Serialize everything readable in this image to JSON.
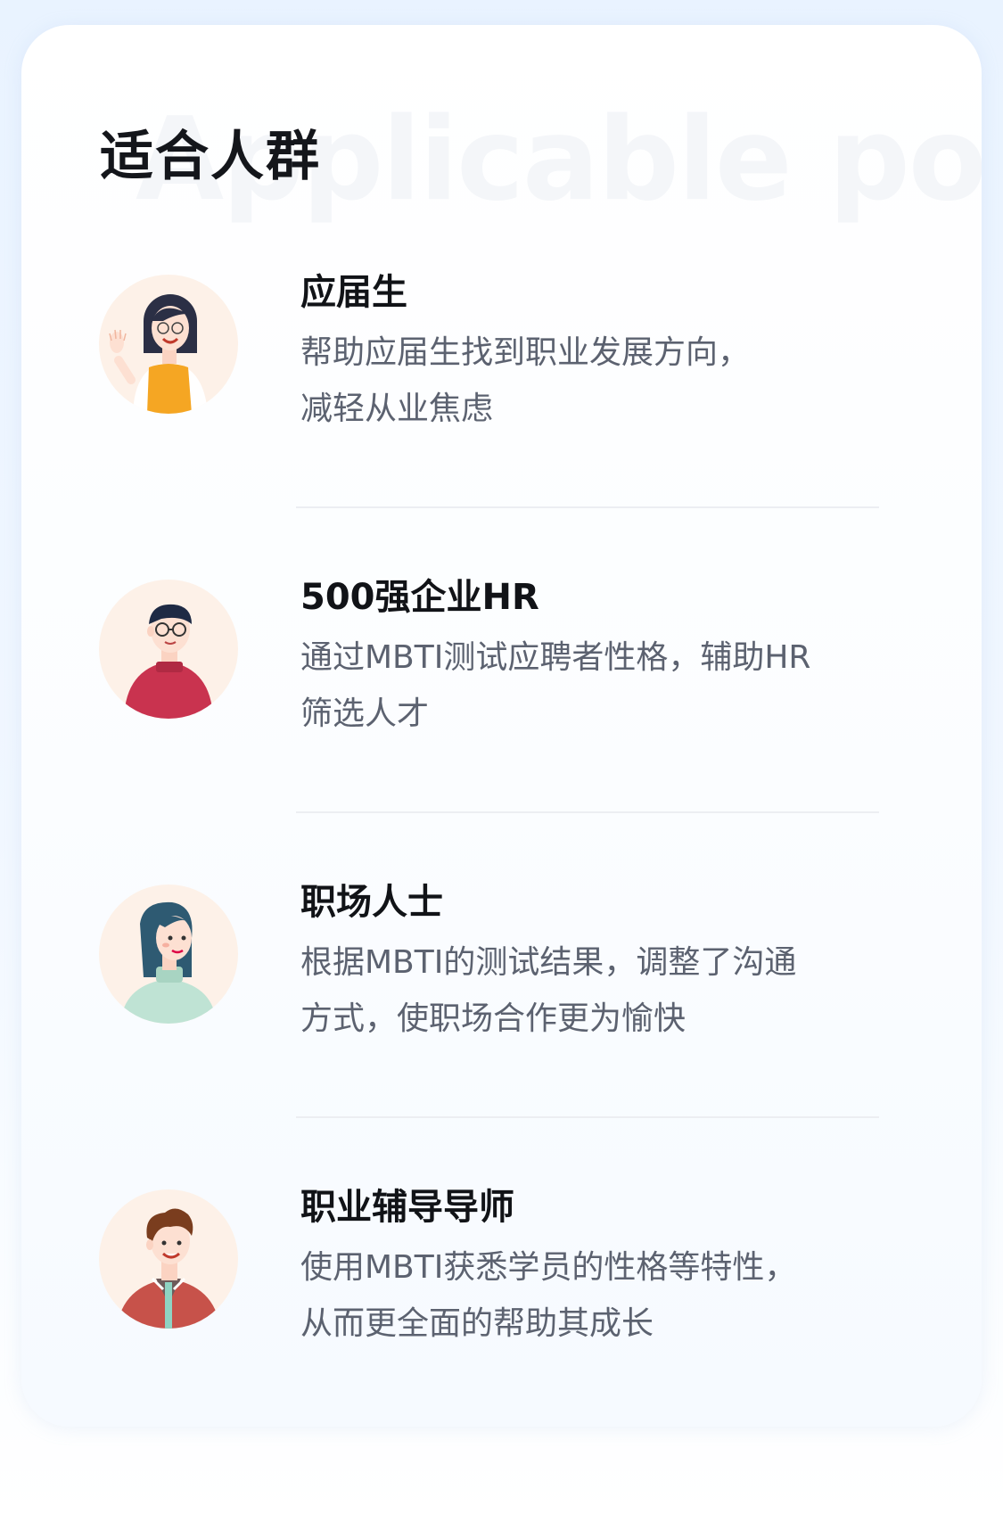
{
  "section": {
    "title": "适合人群",
    "bg_text": "Applicable populati"
  },
  "items": [
    {
      "title": "应届生",
      "desc_lines": [
        "帮助应届生找到职业发展方向，",
        "减轻从业焦虑"
      ],
      "icon": "graduate-woman-avatar-icon"
    },
    {
      "title": "500强企业HR",
      "desc_lines": [
        "通过MBTI测试应聘者性格，辅助HR",
        "筛选人才"
      ],
      "icon": "hr-man-avatar-icon"
    },
    {
      "title": "职场人士",
      "desc_lines": [
        "根据MBTI的测试结果，调整了沟通",
        "方式，使职场合作更为愉快"
      ],
      "icon": "professional-woman-avatar-icon"
    },
    {
      "title": "职业辅导导师",
      "desc_lines": [
        "使用MBTI获悉学员的性格等特性，",
        "从而更全面的帮助其成长"
      ],
      "icon": "mentor-man-avatar-icon"
    }
  ],
  "colors": {
    "page_bg": "#eaf4ff",
    "card_bg": "#ffffff",
    "title": "#14161b",
    "desc": "#5c6270",
    "divider": "#eceef2",
    "avatar_bg": "#fdf1e8"
  }
}
